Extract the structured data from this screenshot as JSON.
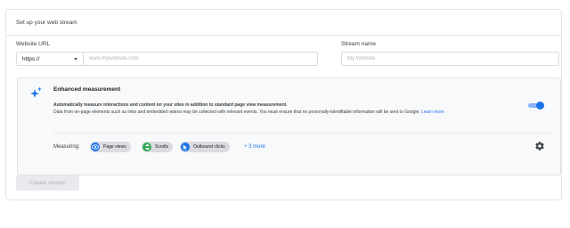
{
  "card": {
    "title": "Set up your web stream"
  },
  "website_url": {
    "label": "Website URL",
    "protocol_value": "https://",
    "placeholder": "www.mywebsite.com"
  },
  "stream_name": {
    "label": "Stream name",
    "placeholder": "My Website"
  },
  "enhanced": {
    "title": "Enhanced measurement",
    "lead": "Automatically measure interactions and content on your sites in addition to standard page view measurement.",
    "body": "Data from on-page elements such as links and embedded videos may be collected with relevant events. You must ensure that no personally-identifiable information will be sent to Google. ",
    "learn_more": "Learn more",
    "toggle_on": true,
    "measuring_label": "Measuring:",
    "chips": [
      {
        "label": "Page views",
        "icon": "eye-icon",
        "color": "#1a73e8"
      },
      {
        "label": "Scrolls",
        "icon": "scroll-icon",
        "color": "#34a853"
      },
      {
        "label": "Outbound clicks",
        "icon": "cursor-click-icon",
        "color": "#1a73e8"
      }
    ],
    "more_link": "+ 3 more"
  },
  "actions": {
    "create_label": "Create stream"
  },
  "colors": {
    "accent": "#1a73e8",
    "chip_green": "#34a853",
    "chip_bg": "#dadce0"
  }
}
